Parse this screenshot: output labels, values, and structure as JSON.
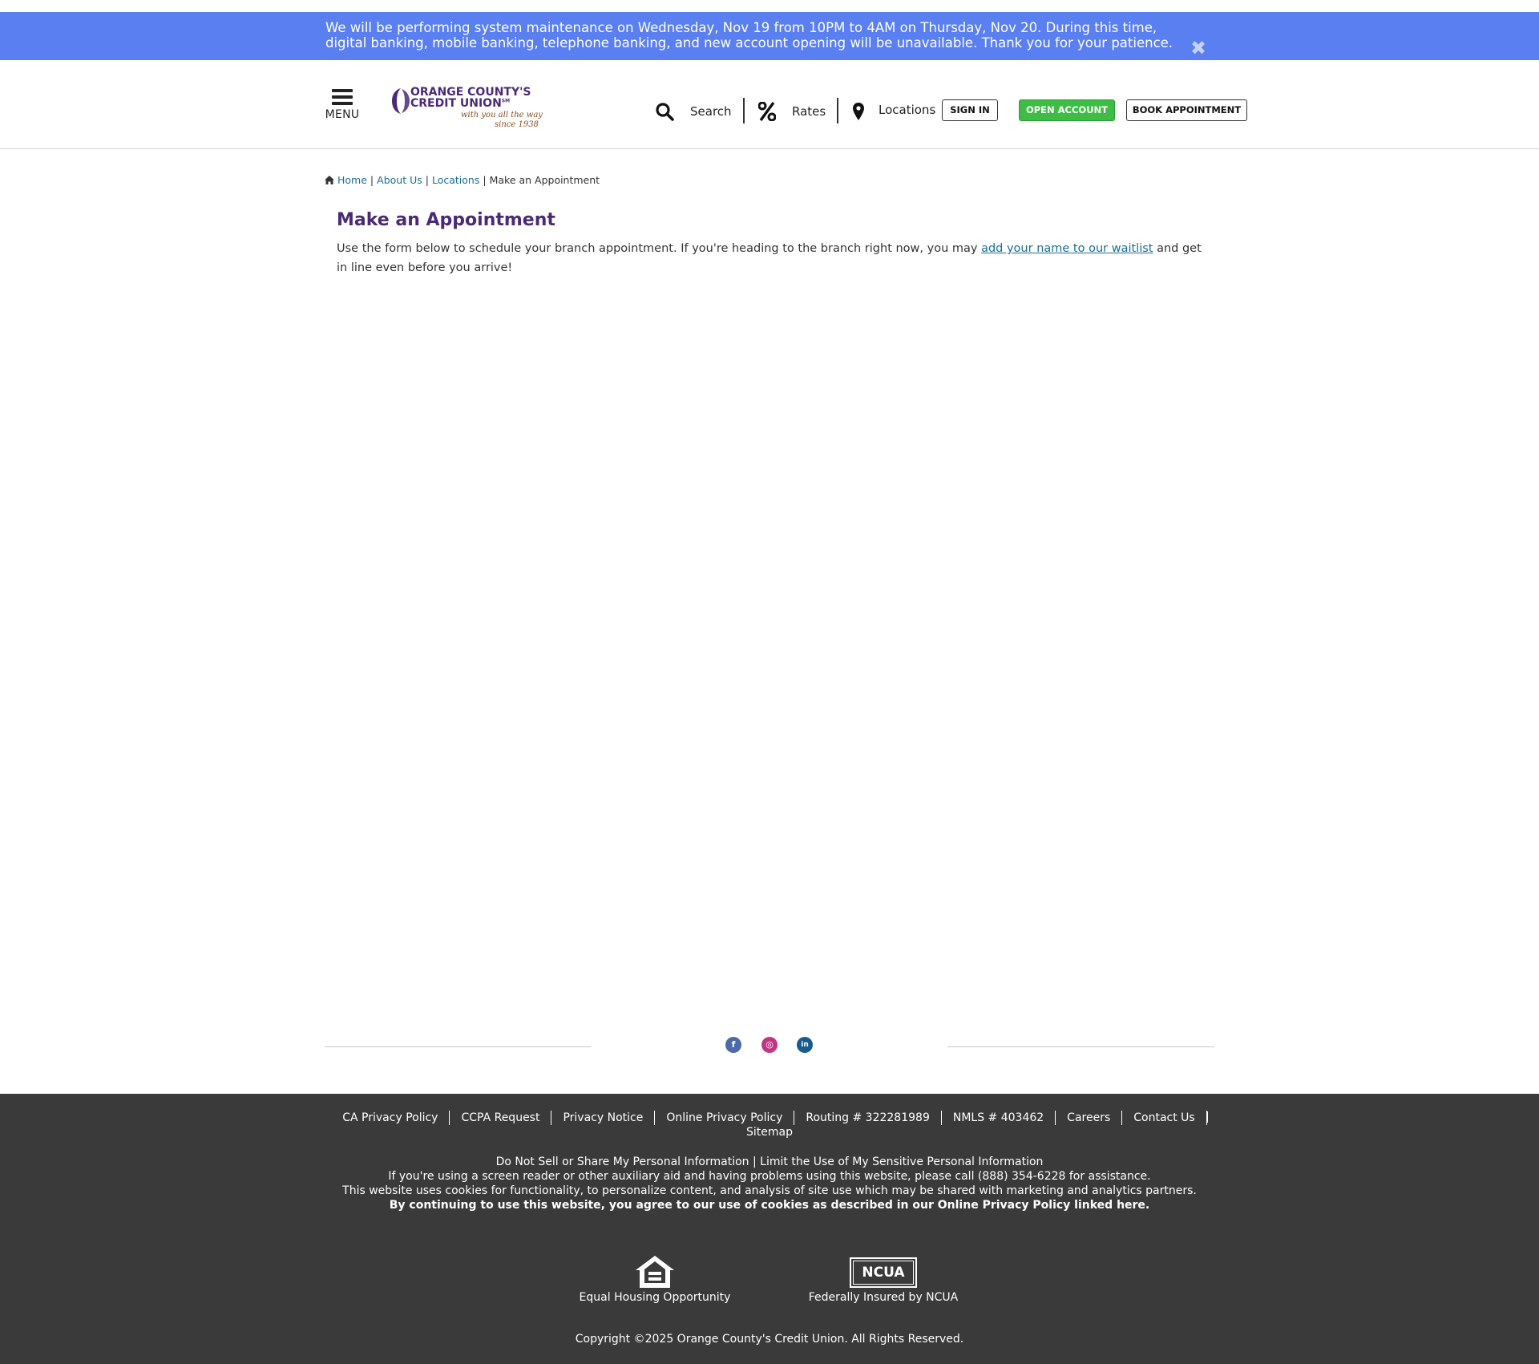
{
  "alert": {
    "message": "We will be performing system maintenance on Wednesday, Nov 19 from 10PM to 4AM on Thursday, Nov 20. During this time, digital banking, mobile banking, telephone banking, and new account opening will be unavailable. Thank you for your patience.",
    "close_glyph": "✖",
    "bg_color": "#5a7ff0"
  },
  "header": {
    "menu_label": "MENU",
    "logo": {
      "line1": "ORANGE COUNTY'S",
      "line2": "CREDIT UNION",
      "tm": "SM",
      "tagline1": "with you all the way",
      "tagline2": "since 1938"
    },
    "nav": {
      "search": "Search",
      "rates": "Rates",
      "locations": "Locations"
    },
    "buttons": {
      "sign_in": "SIGN IN",
      "open_account": "OPEN ACCOUNT",
      "book_appointment": "BOOK APPOINTMENT"
    },
    "brand_color": "#4a2a78",
    "accent_green": "#3ebc46"
  },
  "breadcrumb": {
    "items": [
      "Home",
      "About Us",
      "Locations"
    ],
    "current": "Make an Appointment",
    "separator": "|"
  },
  "main": {
    "title": "Make an Appointment",
    "intro_before": "Use the form below to schedule your branch appointment. If you're heading to the branch right now, you may ",
    "intro_link": "add your name to our waitlist",
    "intro_after": " and get in line even before you arrive!"
  },
  "social": {
    "facebook": "f",
    "instagram": "◎",
    "linkedin": "in"
  },
  "footer": {
    "links": [
      "CA Privacy Policy",
      "CCPA Request",
      "Privacy Notice",
      "Online Privacy Policy",
      "Routing # 322281989",
      "NMLS # 403462",
      "Careers",
      "Contact Us",
      "Sitemap"
    ],
    "ccpa_do_not_sell": "Do Not Sell or Share My Personal Information",
    "ccpa_sep": " | ",
    "ccpa_limit": "Limit the Use of My Sensitive Personal Information",
    "accessibility": "If you're using a screen reader or other auxiliary aid and having problems using this website, please call (888) 354-6228 for assistance.",
    "cookies": "This website uses cookies for functionality, to personalize content, and analysis of site use which may be shared with marketing and analytics partners.",
    "cookies_bold": "By continuing to use this website, you agree to our use of cookies as described in our Online Privacy Policy linked here.",
    "eho_label": "Equal Housing Opportunity",
    "ncua_logo_text": "NCUA",
    "ncua_label": "Federally Insured by NCUA",
    "copyright": "Copyright ©2025 Orange County's Credit Union. All Rights Reserved.",
    "bg_color": "#3a3a3a"
  }
}
